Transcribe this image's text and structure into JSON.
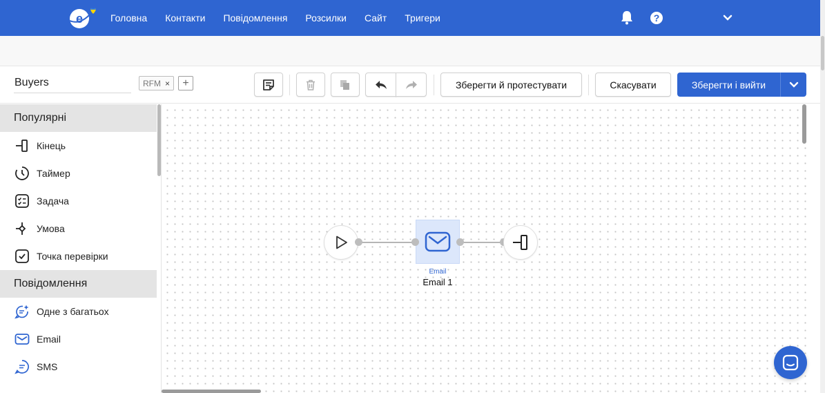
{
  "nav": {
    "items": [
      "Головна",
      "Контакти",
      "Повідомлення",
      "Розсилки",
      "Сайт",
      "Тригери"
    ]
  },
  "toolbar": {
    "workflow_name": "Buyers",
    "tag": "RFM",
    "tag_remove": "×",
    "tag_add": "+",
    "save_test_label": "Зберегти й протестувати",
    "cancel_label": "Скасувати",
    "save_exit_label": "Зберегти і вийти"
  },
  "sidebar": {
    "sections": [
      {
        "title": "Популярні",
        "items": [
          {
            "label": "Кінець",
            "icon": "end-icon"
          },
          {
            "label": "Таймер",
            "icon": "timer-icon"
          },
          {
            "label": "Задача",
            "icon": "task-icon"
          },
          {
            "label": "Умова",
            "icon": "condition-icon"
          },
          {
            "label": "Точка перевірки",
            "icon": "checkpoint-icon"
          }
        ]
      },
      {
        "title": "Повідомлення",
        "items": [
          {
            "label": "Одне з багатьох",
            "icon": "one-of-many-icon"
          },
          {
            "label": "Email",
            "icon": "email-icon"
          },
          {
            "label": "SMS",
            "icon": "sms-icon"
          }
        ]
      }
    ]
  },
  "canvas": {
    "email_node": {
      "type_label": "Email",
      "name": "Email 1"
    }
  },
  "colors": {
    "brand": "#2f65d1",
    "node_highlight": "#dce7fb",
    "section_bg": "#e4e4e4",
    "ukraine_blue": "#2f7de1",
    "ukraine_yellow": "#ffd500"
  }
}
